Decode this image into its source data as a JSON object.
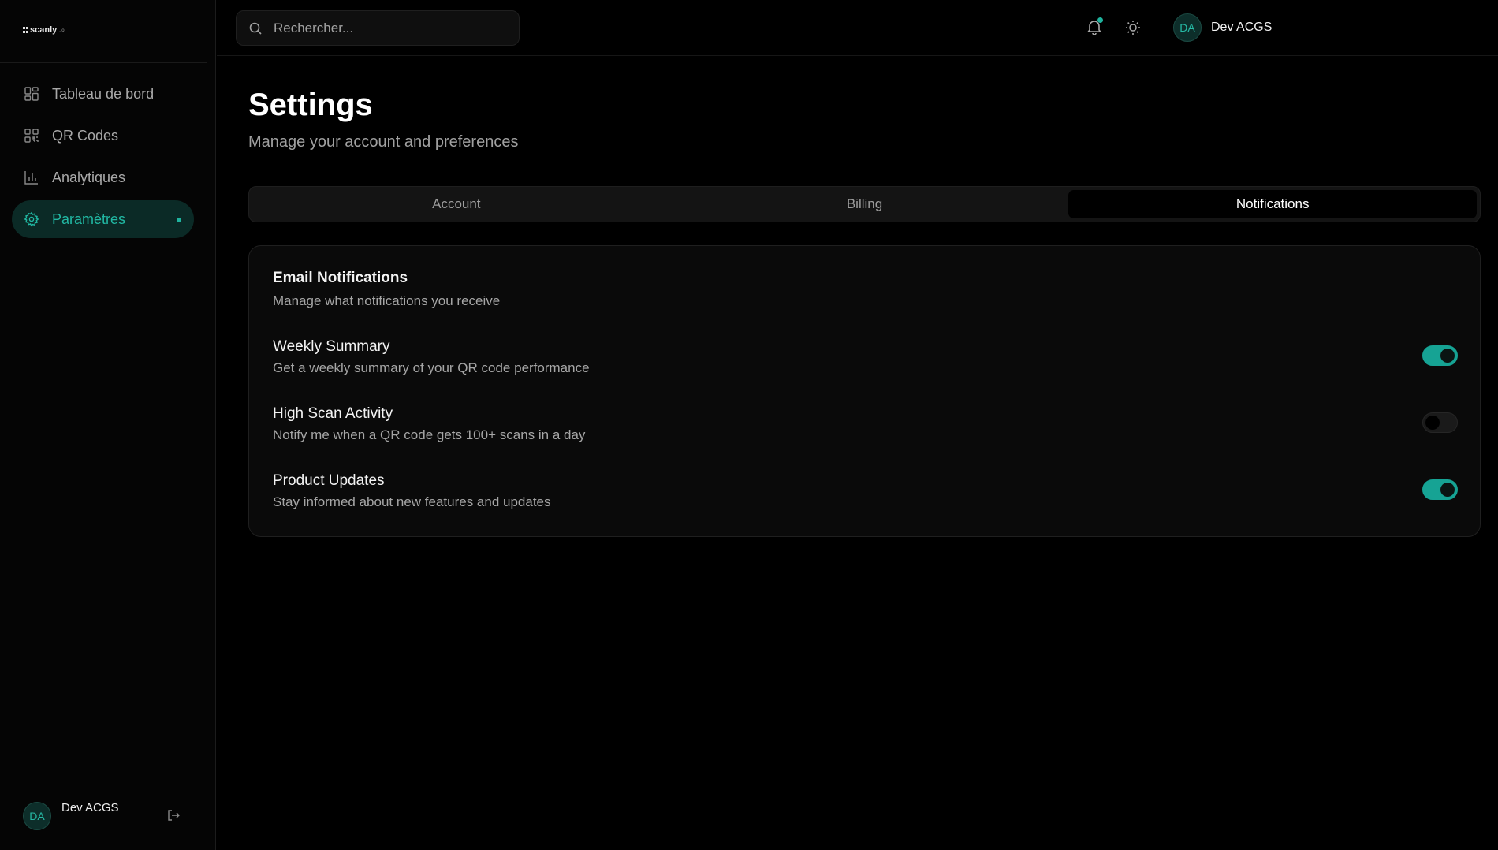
{
  "app": {
    "logo_text": "scanly",
    "logo_tld": ".io"
  },
  "sidebar": {
    "items": [
      {
        "label": "Tableau de bord",
        "icon": "dashboard-icon",
        "active": false
      },
      {
        "label": "QR Codes",
        "icon": "qr-code-icon",
        "active": false
      },
      {
        "label": "Analytiques",
        "icon": "bar-chart-icon",
        "active": false
      },
      {
        "label": "Paramètres",
        "icon": "gear-icon",
        "active": true
      }
    ],
    "user": {
      "initials": "DA",
      "name": "Dev ACGS"
    }
  },
  "topbar": {
    "search_placeholder": "Rechercher...",
    "user": {
      "initials": "DA",
      "name": "Dev ACGS"
    }
  },
  "page": {
    "title": "Settings",
    "subtitle": "Manage your account and preferences",
    "tabs": [
      {
        "label": "Account",
        "active": false
      },
      {
        "label": "Billing",
        "active": false
      },
      {
        "label": "Notifications",
        "active": true
      }
    ]
  },
  "notifications_card": {
    "title": "Email Notifications",
    "description": "Manage what notifications you receive",
    "settings": [
      {
        "label": "Weekly Summary",
        "hint": "Get a weekly summary of your QR code performance",
        "enabled": true
      },
      {
        "label": "High Scan Activity",
        "hint": "Notify me when a QR code gets 100+ scans in a day",
        "enabled": false
      },
      {
        "label": "Product Updates",
        "hint": "Stay informed about new features and updates",
        "enabled": true
      }
    ]
  },
  "colors": {
    "accent": "#1fb39e",
    "background": "#000000",
    "active_nav_bg": "#0b2a26"
  }
}
